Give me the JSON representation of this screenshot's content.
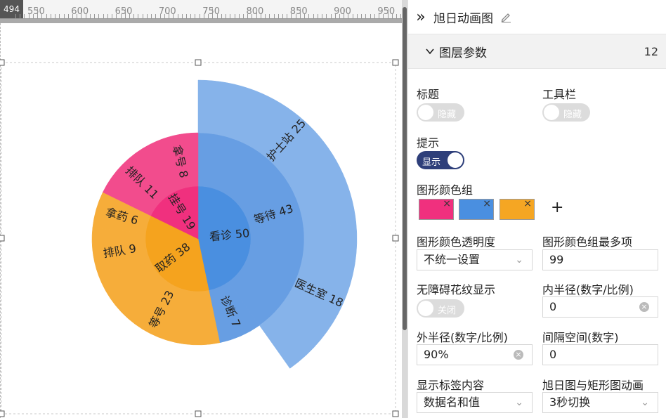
{
  "ruler": {
    "origin": "494",
    "ticks": [
      "550",
      "600",
      "650",
      "700",
      "750",
      "800",
      "850",
      "900",
      "950"
    ]
  },
  "chart_data": {
    "type": "sunburst",
    "title": "",
    "colors": {
      "pink": "#f2468a",
      "orange": "#f5a623",
      "blue": "#4a8fe0"
    },
    "rings": [
      {
        "level": 1,
        "nodes": [
          {
            "name": "看诊",
            "value": 50,
            "group": "blue"
          },
          {
            "name": "取药",
            "value": 38,
            "group": "orange"
          },
          {
            "name": "挂号",
            "value": 19,
            "group": "pink"
          }
        ]
      },
      {
        "level": 2,
        "nodes": [
          {
            "name": "等待",
            "value": 43,
            "parent": "看诊"
          },
          {
            "name": "诊断",
            "value": 7,
            "parent": "看诊"
          },
          {
            "name": "等号",
            "value": 23,
            "parent": "取药"
          },
          {
            "name": "排队",
            "value": 9,
            "parent": "取药"
          },
          {
            "name": "拿药",
            "value": 6,
            "parent": "取药"
          },
          {
            "name": "排队",
            "value": 11,
            "parent": "挂号"
          },
          {
            "name": "拿号",
            "value": 8,
            "parent": "挂号"
          }
        ]
      },
      {
        "level": 3,
        "nodes": [
          {
            "name": "护士站",
            "value": 25,
            "parent": "等待"
          },
          {
            "name": "医生室",
            "value": 18,
            "parent": "等待"
          }
        ]
      }
    ]
  },
  "panel": {
    "title": "旭日动画图",
    "section_title": "图层参数",
    "section_count": "12",
    "title_label": "标题",
    "title_toggle": "隐藏",
    "toolbar_label": "工具栏",
    "toolbar_toggle": "隐藏",
    "tip_label": "提示",
    "tip_toggle": "显示",
    "color_group_label": "图形颜色组",
    "color_swatches": [
      "#f0307e",
      "#4a8fe0",
      "#f5a623"
    ],
    "opacity_label": "图形颜色透明度",
    "opacity_value": "不统一设置",
    "max_items_label": "图形颜色组最多项",
    "max_items_value": "99",
    "pattern_label": "无障碍花纹显示",
    "pattern_toggle": "关闭",
    "inner_radius_label": "内半径(数字/比例)",
    "inner_radius_value": "0",
    "outer_radius_label": "外半径(数字/比例)",
    "outer_radius_value": "90%",
    "gap_label": "间隔空间(数字)",
    "gap_value": "0",
    "label_content_label": "显示标签内容",
    "label_content_value": "数据名和值",
    "animation_label": "旭日图与矩形图动画",
    "animation_value": "3秒切换"
  }
}
